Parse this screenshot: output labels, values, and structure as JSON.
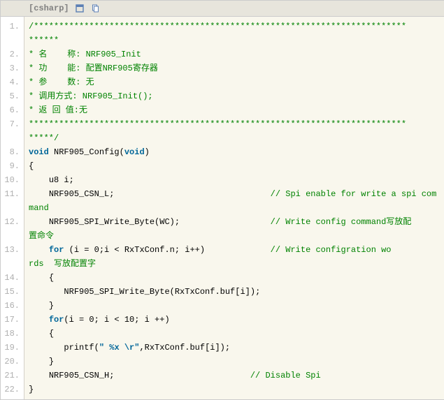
{
  "header": {
    "lang": "[csharp]"
  },
  "lines": [
    {
      "num": "1.",
      "frags": [
        {
          "cls": "cm",
          "txt": "/**************************************************************************"
        }
      ]
    },
    {
      "num": "",
      "frags": [
        {
          "cls": "cm",
          "txt": "******"
        }
      ]
    },
    {
      "num": "2.",
      "frags": [
        {
          "cls": "cm",
          "txt": "* 名    称: NRF905_Init"
        }
      ]
    },
    {
      "num": "3.",
      "frags": [
        {
          "cls": "cm",
          "txt": "* 功    能: 配置NRF905寄存器"
        }
      ]
    },
    {
      "num": "4.",
      "frags": [
        {
          "cls": "cm",
          "txt": "* 参    数: 无"
        }
      ]
    },
    {
      "num": "5.",
      "frags": [
        {
          "cls": "cm",
          "txt": "* 调用方式: NRF905_Init();"
        }
      ]
    },
    {
      "num": "6.",
      "frags": [
        {
          "cls": "cm",
          "txt": "* 返 回 值:无"
        }
      ]
    },
    {
      "num": "7.",
      "frags": [
        {
          "cls": "cm",
          "txt": "***************************************************************************"
        }
      ]
    },
    {
      "num": "",
      "frags": [
        {
          "cls": "cm",
          "txt": "*****/"
        }
      ]
    },
    {
      "num": "8.",
      "frags": [
        {
          "cls": "kw",
          "txt": "void"
        },
        {
          "txt": " NRF905_Config("
        },
        {
          "cls": "kw",
          "txt": "void"
        },
        {
          "txt": ")  "
        }
      ]
    },
    {
      "num": "9.",
      "frags": [
        {
          "txt": "{  "
        }
      ]
    },
    {
      "num": "10.",
      "frags": [
        {
          "txt": "    u8 i;  "
        }
      ]
    },
    {
      "num": "11.",
      "frags": [
        {
          "txt": "    NRF905_CSN_L;                               "
        },
        {
          "cls": "cm",
          "txt": "// Spi enable for write a spi com"
        }
      ]
    },
    {
      "num": "",
      "frags": [
        {
          "cls": "cm",
          "txt": "mand  "
        }
      ]
    },
    {
      "num": "12.",
      "frags": [
        {
          "txt": "    NRF905_SPI_Write_Byte(WC);                  "
        },
        {
          "cls": "cm",
          "txt": "// Write config command写放配"
        }
      ]
    },
    {
      "num": "",
      "frags": [
        {
          "cls": "cm",
          "txt": "置命令  "
        }
      ]
    },
    {
      "num": "13.",
      "frags": [
        {
          "txt": "    "
        },
        {
          "cls": "kw",
          "txt": "for"
        },
        {
          "txt": " (i = 0;i < RxTxConf.n; i++)             "
        },
        {
          "cls": "cm",
          "txt": "// Write configration wo"
        }
      ]
    },
    {
      "num": "",
      "frags": [
        {
          "cls": "cm",
          "txt": "rds  写放配置字  "
        }
      ]
    },
    {
      "num": "14.",
      "frags": [
        {
          "txt": "    {  "
        }
      ]
    },
    {
      "num": "15.",
      "frags": [
        {
          "txt": "       NRF905_SPI_Write_Byte(RxTxConf.buf[i]);  "
        }
      ]
    },
    {
      "num": "16.",
      "frags": [
        {
          "txt": "    }  "
        }
      ]
    },
    {
      "num": "17.",
      "frags": [
        {
          "txt": "    "
        },
        {
          "cls": "kw",
          "txt": "for"
        },
        {
          "txt": "(i = 0; i < 10; i ++)  "
        }
      ]
    },
    {
      "num": "18.",
      "frags": [
        {
          "txt": "    {  "
        }
      ]
    },
    {
      "num": "19.",
      "frags": [
        {
          "txt": "       printf("
        },
        {
          "cls": "kw",
          "txt": "\" %x \\r\""
        },
        {
          "txt": ",RxTxConf.buf[i]);  "
        }
      ]
    },
    {
      "num": "20.",
      "frags": [
        {
          "txt": "    }  "
        }
      ]
    },
    {
      "num": "21.",
      "frags": [
        {
          "txt": "    NRF905_CSN_H;                           "
        },
        {
          "cls": "cm",
          "txt": "// Disable Spi  "
        }
      ]
    },
    {
      "num": "22.",
      "frags": [
        {
          "txt": "}  "
        }
      ]
    }
  ]
}
